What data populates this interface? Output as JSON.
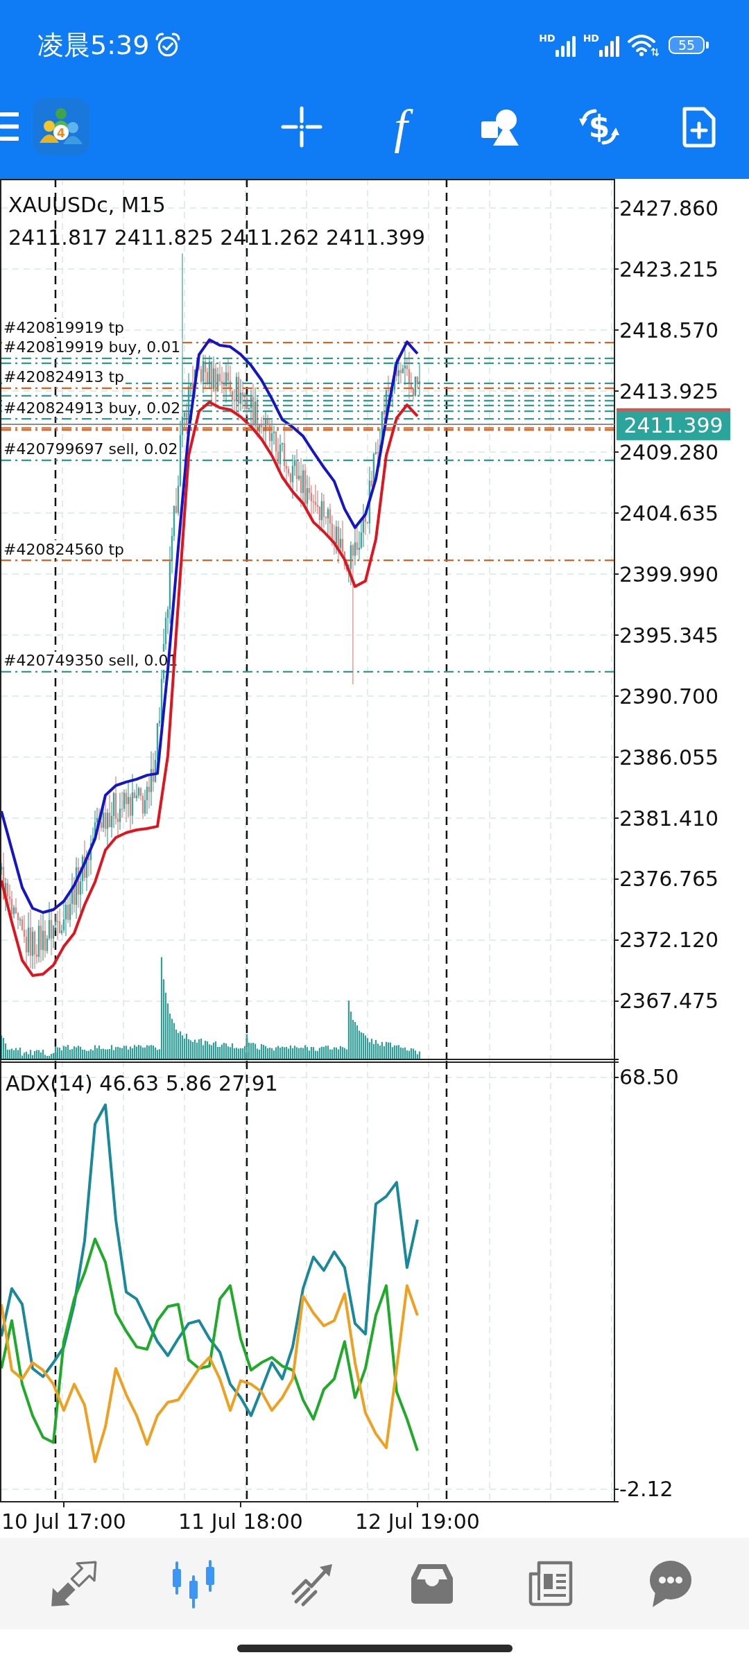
{
  "status_bar": {
    "time": "凌晨5:39",
    "signals": [
      {
        "label": "HD"
      },
      {
        "label": "HD"
      }
    ],
    "battery": "55"
  },
  "toolbar": {
    "logo_badge": "4",
    "tools": [
      {
        "kind": "crosshair"
      },
      {
        "kind": "function",
        "glyph": "f"
      },
      {
        "kind": "shapes"
      },
      {
        "kind": "trade",
        "glyph": "$"
      },
      {
        "kind": "new_document"
      }
    ]
  },
  "chart": {
    "ohlc": "2411.817 2411.825 2411.262 2411.399",
    "chart_data": {
      "type": "line",
      "title": "XAUUSDc, M15",
      "grid": true,
      "categories": [
        null,
        null,
        null,
        null,
        null,
        null,
        null,
        null,
        null,
        null,
        null,
        null,
        null,
        null,
        null,
        null,
        null,
        null,
        null,
        null,
        null,
        null,
        null,
        null,
        null,
        null,
        null,
        null,
        null,
        null,
        null,
        null,
        null,
        null,
        null,
        null,
        null,
        null,
        null,
        null,
        null
      ],
      "ylim": [
        2363.04,
        2430.08
      ],
      "yticks": [
        {
          "value": 2427.86,
          "label": "2427.860"
        },
        {
          "value": 2423.215,
          "label": "2423.215"
        },
        {
          "value": 2418.57,
          "label": "2418.570"
        },
        {
          "value": 2413.925,
          "label": "2413.925"
        },
        {
          "value": 2409.28,
          "label": "2409.280"
        },
        {
          "value": 2404.635,
          "label": "2404.635"
        },
        {
          "value": 2399.99,
          "label": "2399.990"
        },
        {
          "value": 2395.345,
          "label": "2395.345"
        },
        {
          "value": 2390.7,
          "label": "2390.700"
        },
        {
          "value": 2386.055,
          "label": "2386.055"
        },
        {
          "value": 2381.41,
          "label": "2381.410"
        },
        {
          "value": 2376.765,
          "label": "2376.765"
        },
        {
          "value": 2372.12,
          "label": "2372.120"
        },
        {
          "value": 2367.475,
          "label": "2367.475"
        }
      ],
      "series": [
        {
          "color": "#1414c8",
          "values": [
            2381.94,
            2379.03,
            2376.13,
            2374.55,
            2374.23,
            2374.44,
            2375.08,
            2376.29,
            2377.98,
            2379.83,
            2383.15,
            2383.89,
            2384.16,
            2384.37,
            2384.68,
            2384.81,
            2392.7,
            2402.0,
            2410.81,
            2416.7,
            2417.83,
            2417.41,
            2417.3,
            2416.72,
            2415.88,
            2414.77,
            2413.34,
            2411.76,
            2411.18,
            2410.49,
            2409.28,
            2408.12,
            2407.06,
            2404.95,
            2403.53,
            2404.53,
            2407.22,
            2411.81,
            2416.09,
            2417.67,
            2416.78
          ]
        },
        {
          "color": "#e0141e",
          "values": [
            2376.66,
            2373.49,
            2370.59,
            2369.43,
            2369.53,
            2370.22,
            2371.64,
            2372.65,
            2374.81,
            2376.55,
            2378.98,
            2379.93,
            2380.3,
            2380.51,
            2380.62,
            2380.78,
            2386.16,
            2397.72,
            2409.02,
            2412.39,
            2413.08,
            2412.66,
            2412.5,
            2411.97,
            2411.23,
            2410.28,
            2409.02,
            2407.38,
            2406.27,
            2405.37,
            2403.95,
            2403.21,
            2402.36,
            2401.1,
            2399.04,
            2399.46,
            2402.63,
            2409.02,
            2411.87,
            2412.87,
            2412.02
          ]
        }
      ],
      "ref_lines": [
        {
          "axis": "y",
          "value": 2417.62,
          "label": "#420819919 tp",
          "color": "#e0601c"
        },
        {
          "axis": "y",
          "value": 2416.41,
          "label": "#420819919 buy, 0.01",
          "color": "#2b9c94"
        },
        {
          "axis": "y",
          "value": 2416.04,
          "color": "#2b9c94"
        },
        {
          "axis": "y",
          "value": 2414.51,
          "color": "#2b9c94"
        },
        {
          "axis": "y",
          "value": 2414.14,
          "label": "#420824913 tp",
          "color": "#e0601c"
        },
        {
          "axis": "y",
          "value": 2413.56,
          "color": "#2b9c94"
        },
        {
          "axis": "y",
          "value": 2413.19,
          "color": "#2b9c94"
        },
        {
          "axis": "y",
          "value": 2412.82,
          "color": "#2b9c94"
        },
        {
          "axis": "y",
          "value": 2412.39,
          "color": "#2b9c94"
        },
        {
          "axis": "y",
          "value": 2411.81,
          "label": "#420824913 buy, 0.02",
          "color": "#2b9c94"
        },
        {
          "axis": "y",
          "value": 2411.11,
          "color": "#e0601c"
        },
        {
          "axis": "y",
          "value": 2410.96,
          "color": "#e0601c"
        },
        {
          "axis": "y",
          "value": 2408.65,
          "label": "#420799697 sell, 0.02",
          "color": "#2b9c94"
        },
        {
          "axis": "y",
          "value": 2401.04,
          "label": "#420824560 tp",
          "color": "#e0601c"
        },
        {
          "axis": "y",
          "value": 2392.55,
          "label": "#420749350 sell, 0.01",
          "color": "#2b9c94"
        },
        {
          "axis": "y",
          "value": 2411.399,
          "label": "2411.399",
          "color": "#8c8c8c"
        }
      ]
    }
  },
  "indicator": {
    "chart_data": {
      "type": "line",
      "title": "ADX(14) 46.63 5.86 27.91",
      "grid": true,
      "categories": [
        null,
        null,
        null,
        null,
        null,
        null,
        "10 Jul 17:00",
        null,
        null,
        null,
        null,
        null,
        null,
        null,
        null,
        null,
        null,
        null,
        null,
        null,
        null,
        null,
        null,
        "11 Jul 18:00",
        null,
        null,
        null,
        null,
        null,
        null,
        null,
        null,
        null,
        null,
        null,
        null,
        null,
        null,
        null,
        null,
        "12 Jul 19:00"
      ],
      "ylim": [
        -4.26,
        71.35
      ],
      "yticks": [
        {
          "value": 68.5,
          "label": "68.50"
        },
        {
          "value": -2.12,
          "label": "-2.12"
        }
      ],
      "series": [
        {
          "color": "#17899b",
          "values": [
            24.1,
            32.3,
            29.6,
            18.6,
            17.2,
            19.6,
            22.3,
            29.6,
            40.5,
            60.5,
            63.8,
            44.1,
            31.7,
            30.5,
            26.8,
            23.2,
            20.8,
            23.7,
            26.3,
            26.8,
            23.7,
            21.4,
            15.9,
            13.6,
            10.5,
            15.0,
            19.6,
            16.8,
            22.3,
            32.3,
            37.7,
            35.4,
            38.6,
            35.9,
            26.3,
            24.5,
            46.8,
            48.1,
            50.5,
            35.9,
            44.1
          ]
        },
        {
          "color": "#1faa2a",
          "values": [
            18.6,
            26.8,
            15.9,
            10.5,
            6.8,
            5.9,
            23.2,
            30.5,
            35.0,
            40.8,
            36.8,
            28.1,
            25.0,
            22.3,
            21.9,
            26.8,
            29.2,
            29.6,
            20.1,
            18.6,
            19.0,
            30.5,
            32.8,
            23.7,
            18.3,
            19.6,
            20.5,
            19.0,
            18.3,
            13.2,
            9.9,
            15.0,
            16.8,
            23.2,
            13.6,
            18.6,
            27.7,
            32.8,
            14.6,
            9.9,
            4.5
          ]
        },
        {
          "color": "#f0a020",
          "values": [
            29.6,
            18.3,
            16.8,
            19.6,
            18.3,
            15.9,
            11.4,
            15.9,
            12.3,
            2.6,
            8.6,
            18.6,
            14.1,
            10.5,
            5.6,
            10.5,
            12.8,
            13.2,
            15.9,
            18.6,
            20.5,
            16.8,
            11.4,
            16.5,
            15.9,
            14.6,
            11.4,
            13.6,
            16.8,
            31.0,
            28.1,
            25.9,
            26.8,
            31.4,
            19.6,
            11.0,
            7.4,
            5.0,
            18.6,
            32.8,
            27.7
          ]
        }
      ]
    }
  },
  "bottom_nav": [
    {
      "kind": "arrows",
      "selected": false
    },
    {
      "kind": "candles",
      "selected": true
    },
    {
      "kind": "trend",
      "selected": false
    },
    {
      "kind": "tray",
      "selected": false
    },
    {
      "kind": "news",
      "selected": false
    },
    {
      "kind": "chat",
      "selected": false
    }
  ]
}
